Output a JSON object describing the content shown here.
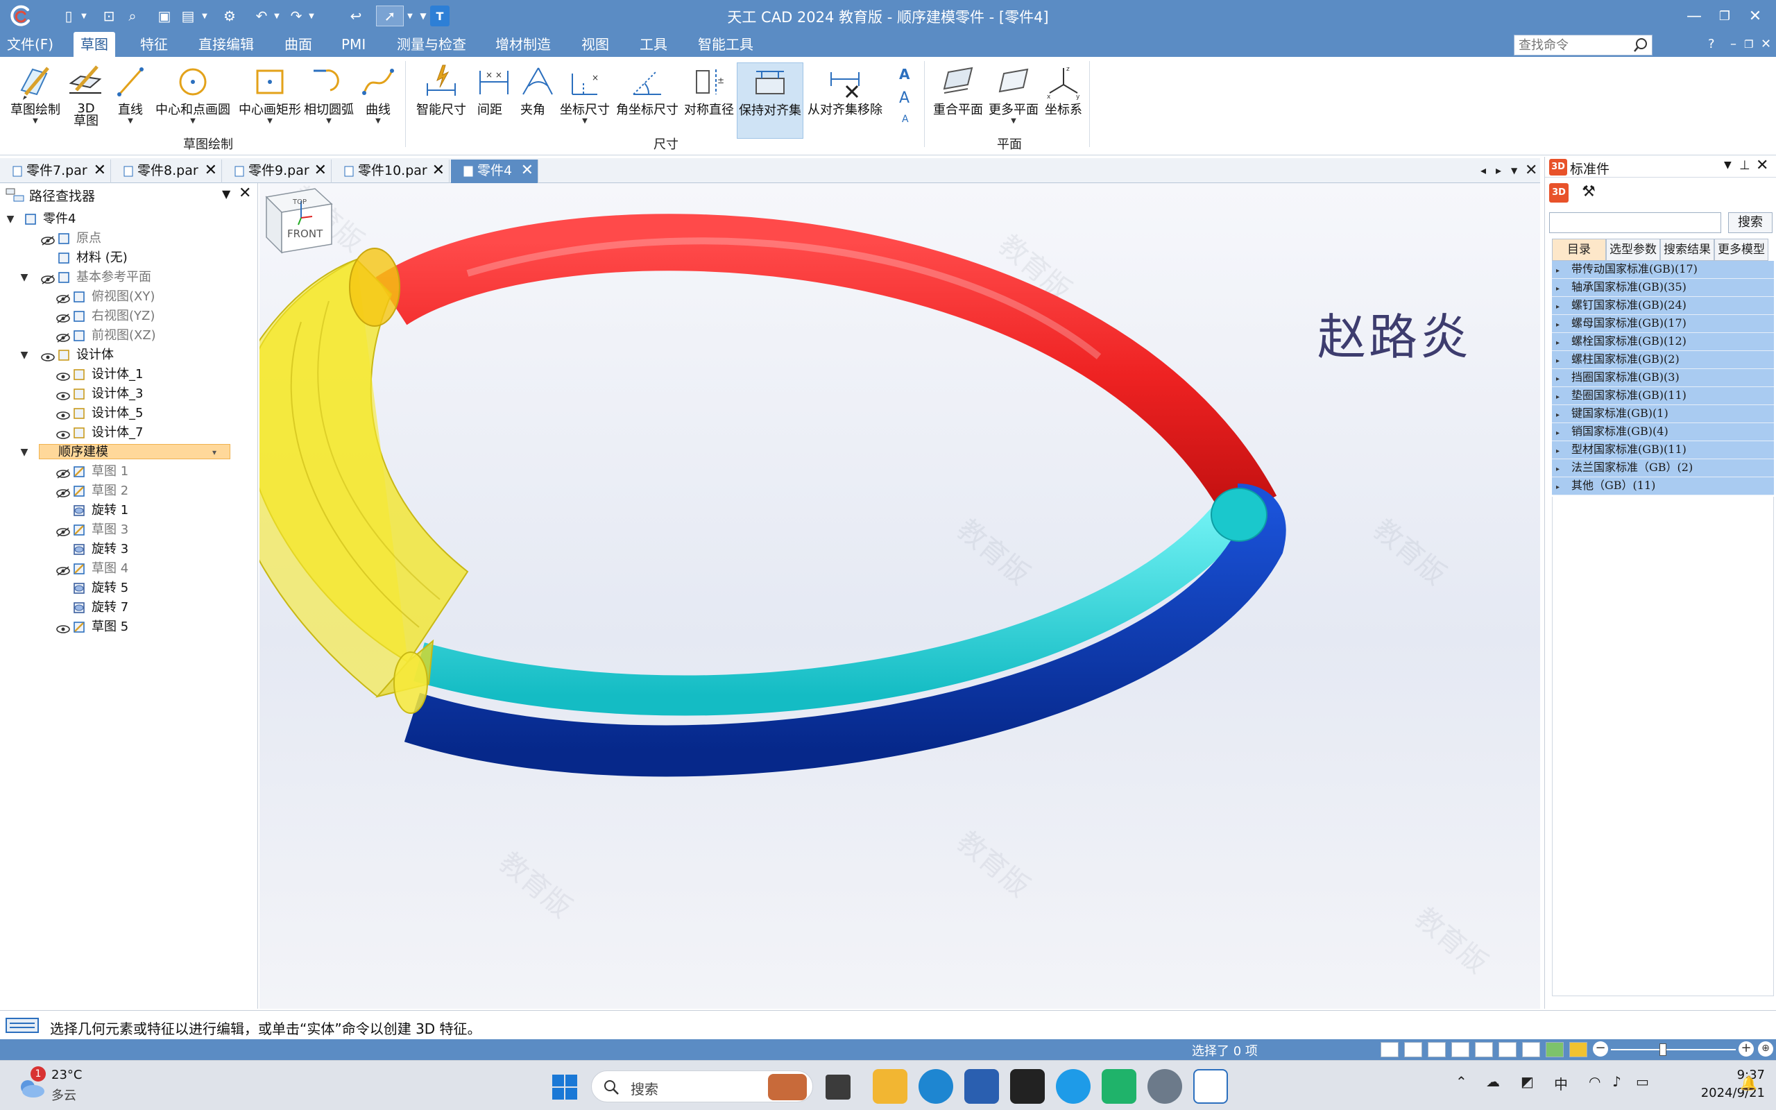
{
  "app": {
    "title": "天工 CAD 2024 教育版 - 顺序建模零件 - [零件4]",
    "brand_color": "#5b8cc4"
  },
  "menu": {
    "items": [
      "文件(F)",
      "草图",
      "特征",
      "直接编辑",
      "曲面",
      "PMI",
      "测量与检查",
      "增材制造",
      "视图",
      "工具",
      "智能工具"
    ],
    "active": "草图",
    "search_placeholder": "查找命令",
    "help": "?"
  },
  "ribbon": {
    "tools": [
      {
        "label": "草图绘制",
        "icon": "sketch-draw-icon"
      },
      {
        "label": "3D",
        "label2": "草图",
        "icon": "3d-sketch-icon"
      },
      {
        "label": "直线",
        "icon": "line-icon"
      },
      {
        "label": "中心和点画圆",
        "icon": "circle-center-point-icon"
      },
      {
        "label": "中心画矩形",
        "icon": "center-rectangle-icon"
      },
      {
        "label": "相切圆弧",
        "icon": "tangent-arc-icon"
      },
      {
        "label": "曲线",
        "icon": "curve-icon"
      },
      {
        "label": "智能尺寸",
        "icon": "smart-dimension-icon"
      },
      {
        "label": "间距",
        "icon": "spacing-dimension-icon"
      },
      {
        "label": "夹角",
        "icon": "angle-dimension-icon"
      },
      {
        "label": "坐标尺寸",
        "icon": "coordinate-dimension-icon"
      },
      {
        "label": "角坐标尺寸",
        "icon": "angular-coordinate-icon"
      },
      {
        "label": "对称直径",
        "icon": "symmetric-diameter-icon"
      },
      {
        "label": "保持对齐集",
        "icon": "keep-align-set-icon"
      },
      {
        "label": "从对齐集移除",
        "icon": "remove-align-set-icon"
      },
      {
        "label": "重合平面",
        "icon": "coincident-plane-icon"
      },
      {
        "label": "更多平面",
        "icon": "more-planes-icon"
      },
      {
        "label": "坐标系",
        "icon": "coordinate-system-icon"
      }
    ],
    "groups": [
      "草图绘制",
      "尺寸",
      "平面"
    ]
  },
  "doc_tabs": [
    {
      "label": "零件7.par",
      "active": false
    },
    {
      "label": "零件8.par",
      "active": false
    },
    {
      "label": "零件9.par",
      "active": false
    },
    {
      "label": "零件10.par",
      "active": false
    },
    {
      "label": "零件4",
      "active": true
    }
  ],
  "pathfinder": {
    "title": "路径查找器",
    "rows": [
      {
        "text": "零件4",
        "level": 0,
        "toggle": "▼",
        "eye": false,
        "dim": false,
        "icon": "part-icon"
      },
      {
        "text": "原点",
        "level": 1,
        "toggle": "",
        "eye": true,
        "dim": true,
        "icon": "origin-icon"
      },
      {
        "text": "材料 (无)",
        "level": 1,
        "toggle": "",
        "eye": false,
        "dim": false,
        "icon": "material-icon"
      },
      {
        "text": "基本参考平面",
        "level": 1,
        "toggle": "▼",
        "eye": true,
        "dim": true,
        "icon": "ref-planes-icon"
      },
      {
        "text": "俯视图(XY)",
        "level": 2,
        "toggle": "",
        "eye": true,
        "dim": true,
        "icon": "plane-icon"
      },
      {
        "text": "右视图(YZ)",
        "level": 2,
        "toggle": "",
        "eye": true,
        "dim": true,
        "icon": "plane-icon"
      },
      {
        "text": "前视图(XZ)",
        "level": 2,
        "toggle": "",
        "eye": true,
        "dim": true,
        "icon": "plane-icon"
      },
      {
        "text": "设计体",
        "level": 1,
        "toggle": "▼",
        "eye": true,
        "dim": false,
        "icon": "design-body-icon"
      },
      {
        "text": "设计体_1",
        "level": 2,
        "toggle": "",
        "eye": true,
        "dim": false,
        "icon": "body-icon"
      },
      {
        "text": "设计体_3",
        "level": 2,
        "toggle": "",
        "eye": true,
        "dim": false,
        "icon": "body-icon"
      },
      {
        "text": "设计体_5",
        "level": 2,
        "toggle": "",
        "eye": true,
        "dim": false,
        "icon": "body-icon"
      },
      {
        "text": "设计体_7",
        "level": 2,
        "toggle": "",
        "eye": true,
        "dim": false,
        "icon": "body-icon"
      },
      {
        "text": "顺序建模",
        "level": 1,
        "toggle": "▼",
        "eye": false,
        "dim": false,
        "icon": "",
        "highlight": true
      },
      {
        "text": "草图 1",
        "level": 2,
        "toggle": "",
        "eye": true,
        "dim": true,
        "icon": "sketch-icon"
      },
      {
        "text": "草图 2",
        "level": 2,
        "toggle": "",
        "eye": true,
        "dim": true,
        "icon": "sketch-icon"
      },
      {
        "text": "旋转 1",
        "level": 2,
        "toggle": "",
        "eye": false,
        "dim": false,
        "icon": "revolve-icon"
      },
      {
        "text": "草图 3",
        "level": 2,
        "toggle": "",
        "eye": true,
        "dim": true,
        "icon": "sketch-icon"
      },
      {
        "text": "旋转 3",
        "level": 2,
        "toggle": "",
        "eye": false,
        "dim": false,
        "icon": "revolve-icon"
      },
      {
        "text": "草图 4",
        "level": 2,
        "toggle": "",
        "eye": true,
        "dim": true,
        "icon": "sketch-icon"
      },
      {
        "text": "旋转 5",
        "level": 2,
        "toggle": "",
        "eye": false,
        "dim": false,
        "icon": "revolve-icon"
      },
      {
        "text": "旋转 7",
        "level": 2,
        "toggle": "",
        "eye": false,
        "dim": false,
        "icon": "revolve-icon"
      },
      {
        "text": "草图 5",
        "level": 2,
        "toggle": "",
        "eye": true,
        "dim": false,
        "icon": "sketch-icon"
      }
    ]
  },
  "viewport": {
    "author_name": "赵路炎",
    "watermark": "教育版",
    "viewcube_top": "TOP",
    "viewcube_front": "FRONT",
    "model_colors": {
      "red": "#ee2a2a",
      "blue": "#0a3cb8",
      "cyan": "#22d4d8",
      "yellow": "#f2e628"
    }
  },
  "standard_parts": {
    "title": "标准件",
    "search_button": "搜索",
    "tabs": [
      "目录",
      "选型参数",
      "搜索结果",
      "更多模型"
    ],
    "active_tab": "目录",
    "items": [
      "带传动国家标准(GB)(17)",
      "轴承国家标准(GB)(35)",
      "螺钉国家标准(GB)(24)",
      "螺母国家标准(GB)(17)",
      "螺栓国家标准(GB)(12)",
      "螺柱国家标准(GB)(2)",
      "挡圈国家标准(GB)(3)",
      "垫圈国家标准(GB)(11)",
      "键国家标准(GB)(1)",
      "销国家标准(GB)(4)",
      "型材国家标准(GB)(11)",
      "法兰国家标准（GB）(2)",
      "其他（GB）(11)"
    ]
  },
  "status": {
    "prompt": "选择几何元素或特征以进行编辑，或单击“实体”命令以创建 3D 特征。",
    "selection": "选择了 0 项"
  },
  "taskbar": {
    "weather_badge": "1",
    "temperature": "23°C",
    "weather": "多云",
    "search_placeholder": "搜索",
    "ime": "中",
    "time": "9:37",
    "date": "2024/9/21"
  }
}
